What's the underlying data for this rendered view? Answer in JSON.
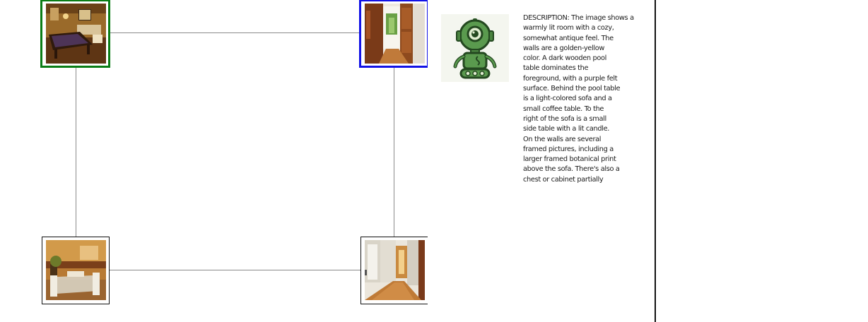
{
  "graph": {
    "nodes": [
      {
        "id": "billiard-room",
        "scene": "Room with pool table and sofa",
        "state": "current"
      },
      {
        "id": "entry-hallway",
        "scene": "Entry hallway with open wooden door",
        "state": "selected"
      },
      {
        "id": "dining-room",
        "scene": "Dining room with glass table and chairs",
        "state": "default"
      },
      {
        "id": "long-hallway",
        "scene": "Long hallway with hardwood floor",
        "state": "default"
      }
    ],
    "edges": [
      [
        "billiard-room",
        "entry-hallway"
      ],
      [
        "billiard-room",
        "dining-room"
      ],
      [
        "entry-hallway",
        "long-hallway"
      ],
      [
        "dining-room",
        "long-hallway"
      ]
    ],
    "colors": {
      "current_border": "#0a7d16",
      "selected_border": "#1212e6",
      "default_border": "#111111",
      "edge": "#8a8a8a"
    }
  },
  "agent": {
    "icon": "robot-icon",
    "color": "#5a9a4e"
  },
  "description": {
    "text": "DESCRIPTION: The image shows a\nwarmly lit room with a cozy,\nsomewhat antique feel. The\nwalls are a golden-yellow\ncolor. A dark wooden pool\ntable dominates the\nforeground, with a purple felt\nsurface. Behind the pool table\nis a light-colored sofa and a\nsmall coffee table. To the\nright of the sofa is a small\nside table with a lit candle.\nOn the walls are several\nframed pictures, including a\nlarger framed botanical print\nabove the sofa. There's also a\nchest or cabinet partially"
  }
}
